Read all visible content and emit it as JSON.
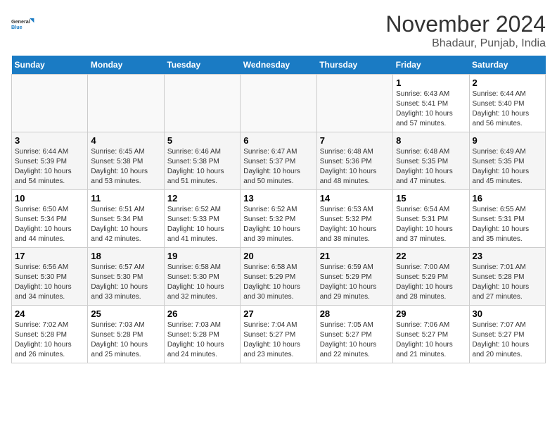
{
  "logo": {
    "text1": "General",
    "text2": "Blue"
  },
  "title": "November 2024",
  "subtitle": "Bhadaur, Punjab, India",
  "weekdays": [
    "Sunday",
    "Monday",
    "Tuesday",
    "Wednesday",
    "Thursday",
    "Friday",
    "Saturday"
  ],
  "weeks": [
    [
      {
        "day": "",
        "info": ""
      },
      {
        "day": "",
        "info": ""
      },
      {
        "day": "",
        "info": ""
      },
      {
        "day": "",
        "info": ""
      },
      {
        "day": "",
        "info": ""
      },
      {
        "day": "1",
        "info": "Sunrise: 6:43 AM\nSunset: 5:41 PM\nDaylight: 10 hours and 57 minutes."
      },
      {
        "day": "2",
        "info": "Sunrise: 6:44 AM\nSunset: 5:40 PM\nDaylight: 10 hours and 56 minutes."
      }
    ],
    [
      {
        "day": "3",
        "info": "Sunrise: 6:44 AM\nSunset: 5:39 PM\nDaylight: 10 hours and 54 minutes."
      },
      {
        "day": "4",
        "info": "Sunrise: 6:45 AM\nSunset: 5:38 PM\nDaylight: 10 hours and 53 minutes."
      },
      {
        "day": "5",
        "info": "Sunrise: 6:46 AM\nSunset: 5:38 PM\nDaylight: 10 hours and 51 minutes."
      },
      {
        "day": "6",
        "info": "Sunrise: 6:47 AM\nSunset: 5:37 PM\nDaylight: 10 hours and 50 minutes."
      },
      {
        "day": "7",
        "info": "Sunrise: 6:48 AM\nSunset: 5:36 PM\nDaylight: 10 hours and 48 minutes."
      },
      {
        "day": "8",
        "info": "Sunrise: 6:48 AM\nSunset: 5:35 PM\nDaylight: 10 hours and 47 minutes."
      },
      {
        "day": "9",
        "info": "Sunrise: 6:49 AM\nSunset: 5:35 PM\nDaylight: 10 hours and 45 minutes."
      }
    ],
    [
      {
        "day": "10",
        "info": "Sunrise: 6:50 AM\nSunset: 5:34 PM\nDaylight: 10 hours and 44 minutes."
      },
      {
        "day": "11",
        "info": "Sunrise: 6:51 AM\nSunset: 5:34 PM\nDaylight: 10 hours and 42 minutes."
      },
      {
        "day": "12",
        "info": "Sunrise: 6:52 AM\nSunset: 5:33 PM\nDaylight: 10 hours and 41 minutes."
      },
      {
        "day": "13",
        "info": "Sunrise: 6:52 AM\nSunset: 5:32 PM\nDaylight: 10 hours and 39 minutes."
      },
      {
        "day": "14",
        "info": "Sunrise: 6:53 AM\nSunset: 5:32 PM\nDaylight: 10 hours and 38 minutes."
      },
      {
        "day": "15",
        "info": "Sunrise: 6:54 AM\nSunset: 5:31 PM\nDaylight: 10 hours and 37 minutes."
      },
      {
        "day": "16",
        "info": "Sunrise: 6:55 AM\nSunset: 5:31 PM\nDaylight: 10 hours and 35 minutes."
      }
    ],
    [
      {
        "day": "17",
        "info": "Sunrise: 6:56 AM\nSunset: 5:30 PM\nDaylight: 10 hours and 34 minutes."
      },
      {
        "day": "18",
        "info": "Sunrise: 6:57 AM\nSunset: 5:30 PM\nDaylight: 10 hours and 33 minutes."
      },
      {
        "day": "19",
        "info": "Sunrise: 6:58 AM\nSunset: 5:30 PM\nDaylight: 10 hours and 32 minutes."
      },
      {
        "day": "20",
        "info": "Sunrise: 6:58 AM\nSunset: 5:29 PM\nDaylight: 10 hours and 30 minutes."
      },
      {
        "day": "21",
        "info": "Sunrise: 6:59 AM\nSunset: 5:29 PM\nDaylight: 10 hours and 29 minutes."
      },
      {
        "day": "22",
        "info": "Sunrise: 7:00 AM\nSunset: 5:29 PM\nDaylight: 10 hours and 28 minutes."
      },
      {
        "day": "23",
        "info": "Sunrise: 7:01 AM\nSunset: 5:28 PM\nDaylight: 10 hours and 27 minutes."
      }
    ],
    [
      {
        "day": "24",
        "info": "Sunrise: 7:02 AM\nSunset: 5:28 PM\nDaylight: 10 hours and 26 minutes."
      },
      {
        "day": "25",
        "info": "Sunrise: 7:03 AM\nSunset: 5:28 PM\nDaylight: 10 hours and 25 minutes."
      },
      {
        "day": "26",
        "info": "Sunrise: 7:03 AM\nSunset: 5:28 PM\nDaylight: 10 hours and 24 minutes."
      },
      {
        "day": "27",
        "info": "Sunrise: 7:04 AM\nSunset: 5:27 PM\nDaylight: 10 hours and 23 minutes."
      },
      {
        "day": "28",
        "info": "Sunrise: 7:05 AM\nSunset: 5:27 PM\nDaylight: 10 hours and 22 minutes."
      },
      {
        "day": "29",
        "info": "Sunrise: 7:06 AM\nSunset: 5:27 PM\nDaylight: 10 hours and 21 minutes."
      },
      {
        "day": "30",
        "info": "Sunrise: 7:07 AM\nSunset: 5:27 PM\nDaylight: 10 hours and 20 minutes."
      }
    ]
  ]
}
